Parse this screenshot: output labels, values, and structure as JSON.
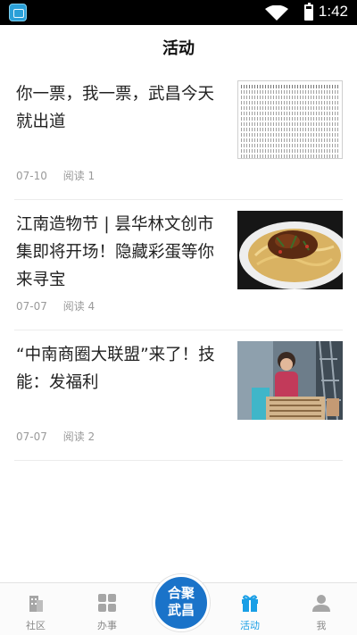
{
  "status_bar": {
    "time": "1:42"
  },
  "header": {
    "title": "活动"
  },
  "articles": [
    {
      "title": "你一票，我一票，武昌今天就出道",
      "date": "07-10",
      "reads": "阅读 1",
      "thumb": "table-document-image"
    },
    {
      "title": "江南造物节 | 昙华林文创市集即将开场！隐藏彩蛋等你来寻宝",
      "date": "07-07",
      "reads": "阅读 4",
      "thumb": "noodle-dish-image"
    },
    {
      "title": "“中南商圈大联盟”来了！技能：发福利",
      "date": "07-07",
      "reads": "阅读 2",
      "thumb": "stage-performer-image"
    }
  ],
  "nav": {
    "items": [
      {
        "label": "社区",
        "icon": "building-icon"
      },
      {
        "label": "办事",
        "icon": "grid-icon"
      },
      {
        "label": "活动",
        "icon": "gift-icon"
      },
      {
        "label": "我",
        "icon": "person-icon"
      }
    ],
    "center_logo": "合聚武昌",
    "active_color": "#1a9fe6"
  }
}
